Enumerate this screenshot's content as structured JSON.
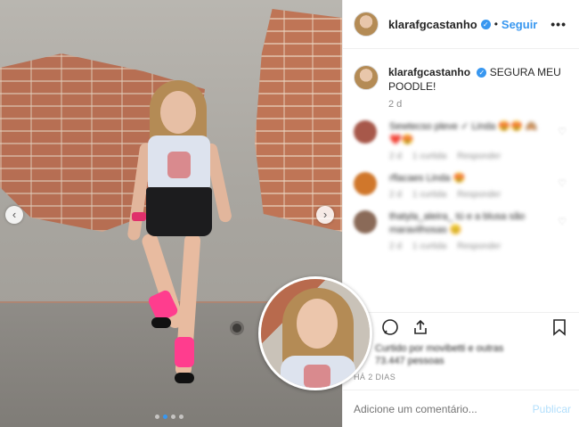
{
  "post": {
    "username": "klarafgcastanho",
    "separator": "•",
    "follow_label": "Seguir",
    "more_icon": "•••",
    "caption": "SEGURA MEU POODLE!",
    "time_ago": "2 d",
    "date": "HÁ 2 DIAS",
    "carousel": {
      "slides": 4,
      "active": 2
    }
  },
  "comments": [
    {
      "text": "Sewtecso pleve ✓ Linda 😍😍 🙈 ❤️😍",
      "time": "2 d",
      "likes": "1 curtida",
      "reply": "Responder",
      "avatar_color": "#a7584a"
    },
    {
      "text": "rflacaes Linda 😍",
      "time": "2 d",
      "likes": "1 curtida",
      "reply": "Responder",
      "avatar_color": "#d0772b"
    },
    {
      "text": "thatyla_aleira_ tú e a blusa são maravilhosas 😊",
      "time": "2 d",
      "likes": "1 curtida",
      "reply": "Responder",
      "avatar_color": "#8a6a58"
    }
  ],
  "footer": {
    "likes_text": "Curtido por movibetti e outras 73.447 pessoas",
    "comment_placeholder": "Adicione um comentário...",
    "publish_label": "Publicar"
  },
  "icons": {
    "comment": "comment-bubble-icon",
    "share": "share-icon",
    "bookmark": "bookmark-icon",
    "verified": "verified-badge-icon",
    "heart": "heart-icon"
  },
  "colors": {
    "accent": "#3897f0",
    "publish_disabled": "#b2dffc",
    "legwarmer": "#ff3d8e"
  }
}
